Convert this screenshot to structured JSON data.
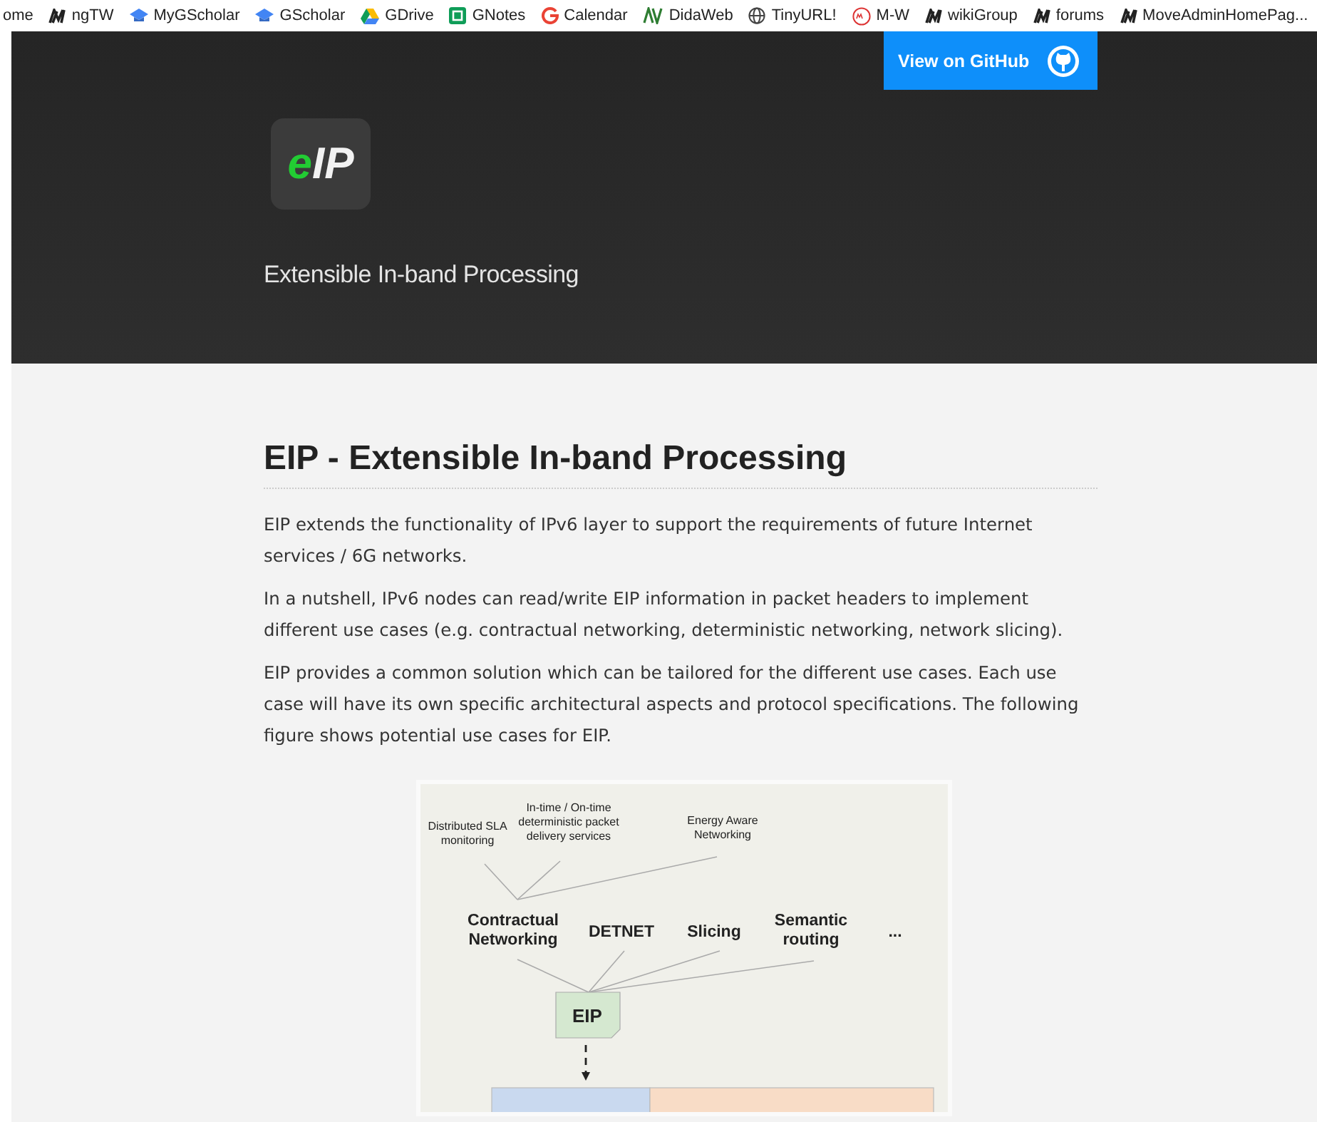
{
  "bookmarks": [
    {
      "label": "ome",
      "kind": "none"
    },
    {
      "label": "ngTW",
      "kind": "n"
    },
    {
      "label": "MyGScholar",
      "kind": "cap"
    },
    {
      "label": "GScholar",
      "kind": "cap"
    },
    {
      "label": "GDrive",
      "kind": "drive"
    },
    {
      "label": "GNotes",
      "kind": "notes"
    },
    {
      "label": "Calendar",
      "kind": "g"
    },
    {
      "label": "DidaWeb",
      "kind": "dida"
    },
    {
      "label": "TinyURL!",
      "kind": "globe"
    },
    {
      "label": "M-W",
      "kind": "mw"
    },
    {
      "label": "wikiGroup",
      "kind": "n"
    },
    {
      "label": "forums",
      "kind": "n"
    },
    {
      "label": "MoveAdminHomePag...",
      "kind": "n"
    }
  ],
  "header": {
    "github_button": "View on GitHub",
    "logo": {
      "e": "e",
      "ip": "IP"
    },
    "subtitle": "Extensible In-band Processing"
  },
  "content": {
    "title": "EIP - Extensible In-band Processing",
    "paragraphs": [
      "EIP extends the functionality of IPv6 layer to support the requirements of future Internet services / 6G networks.",
      "In a nutshell, IPv6 nodes can read/write EIP information in packet headers to implement different use cases (e.g. contractual networking, deterministic networking, network slicing).",
      "EIP provides a common solution which can be tailored for the different use cases. Each use case will have its own specific architectural aspects and protocol specifications. The following figure shows potential use cases for EIP."
    ],
    "figure": {
      "services": [
        "Distributed SLA monitoring",
        "In-time / On-time deterministic packet delivery services",
        "Energy Aware Networking"
      ],
      "use_cases": [
        "Contractual Networking",
        "DETNET",
        "Slicing",
        "Semantic routing",
        "..."
      ],
      "core": "EIP"
    }
  }
}
